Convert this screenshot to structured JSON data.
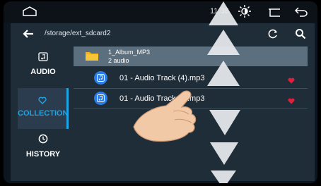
{
  "status": {
    "time": "11:38"
  },
  "path": {
    "text": "/storage/ext_sdcard2"
  },
  "sidebar": {
    "items": [
      {
        "label": "AUDIO",
        "icon": "music-folder-icon"
      },
      {
        "label": "COLLECTION",
        "icon": "heart-outline-icon",
        "selected": true
      },
      {
        "label": "HISTORY",
        "icon": "clock-icon"
      }
    ]
  },
  "list": {
    "folder": {
      "title": "1_Album_MP3",
      "subtitle": "2 audio"
    },
    "tracks": [
      {
        "title": "01 - Audio Track (4).mp3",
        "favorite": true
      },
      {
        "title": "01 - Audio Track (3).mp3",
        "favorite": true
      }
    ]
  },
  "colors": {
    "accent": "#1ea5e6",
    "favorite": "#e0203a",
    "badge": "#2b7ee9"
  }
}
